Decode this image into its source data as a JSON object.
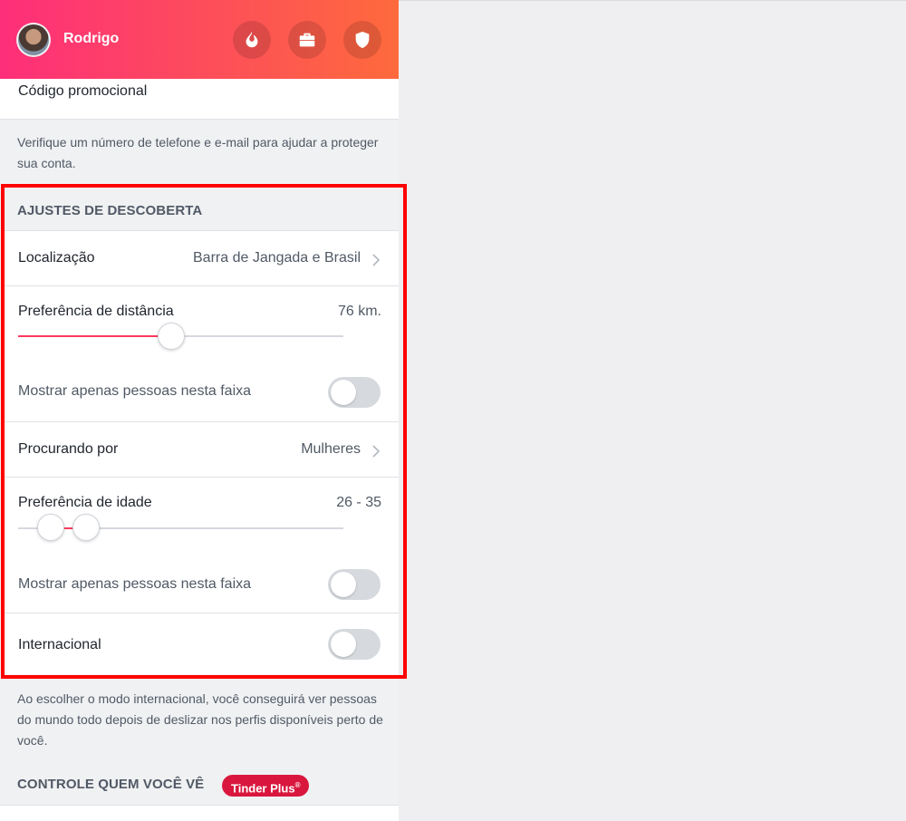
{
  "header": {
    "username": "Rodrigo",
    "icons": [
      "flame-icon",
      "briefcase-icon",
      "shield-icon"
    ]
  },
  "promo": {
    "label": "Código promocional"
  },
  "verify_note": "Verifique um número de telefone e e-mail para ajudar a proteger sua conta.",
  "discovery": {
    "title": "AJUSTES DE DESCOBERTA",
    "location": {
      "label": "Localização",
      "value": "Barra de Jangada e Brasil"
    },
    "distance": {
      "label": "Preferência de distância",
      "value": "76 km.",
      "fraction": 0.47
    },
    "distance_only": {
      "label": "Mostrar apenas pessoas nesta faixa",
      "on": false
    },
    "looking_for": {
      "label": "Procurando por",
      "value": "Mulheres"
    },
    "age": {
      "label": "Preferência de idade",
      "value": "26 - 35",
      "low_fraction": 0.1,
      "high_fraction": 0.21
    },
    "age_only": {
      "label": "Mostrar apenas pessoas nesta faixa",
      "on": false
    },
    "international": {
      "label": "Internacional",
      "on": false
    }
  },
  "international_note": "Ao escolher o modo internacional, você conseguirá ver pessoas do mundo todo depois de deslizar nos perfis disponíveis perto de você.",
  "control": {
    "title": "CONTROLE QUEM VOCÊ VÊ",
    "badge": "Tinder Plus",
    "badge_mark": "®"
  },
  "colors": {
    "accent": "#fd3a5e",
    "highlight": "#ff0000",
    "badge": "#d9173e"
  }
}
